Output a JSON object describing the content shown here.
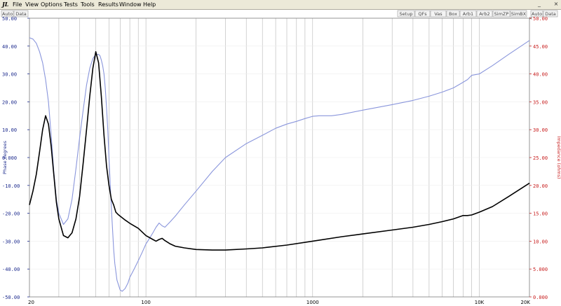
{
  "menubar": {
    "items": [
      "File",
      "View",
      "Options",
      "Tests",
      "Tools",
      "Results",
      "Window",
      "Help"
    ],
    "window_controls": [
      "_",
      "×"
    ]
  },
  "toolbar": {
    "left_buttons": [
      "Auto",
      "Data"
    ],
    "right_buttons": [
      "Setup",
      "QFs",
      "Vas",
      "Box",
      "Arb1",
      "Arb2",
      "SimZP",
      "SimBX"
    ],
    "right_axis_buttons": [
      "Auto",
      "Data"
    ],
    "close_glyph": "×"
  },
  "colors": {
    "phase": "#8a96dc",
    "impedance": "#000000",
    "left_axis": "#1e2c8e",
    "right_axis": "#c82020",
    "grid": "#b4b4b4"
  },
  "chart_data": {
    "type": "line",
    "xscale": "log",
    "xlim": [
      20,
      20000
    ],
    "x_tick_labels": [
      "20",
      "100",
      "1000",
      "10K",
      "20K"
    ],
    "ylabel": "Phase degrees",
    "ylim": [
      -50,
      50
    ],
    "y_tick_labels": [
      "50.00",
      "40.00",
      "30.00",
      "20.00",
      "10.00",
      "0.000",
      "-10.00",
      "-20.00",
      "-30.00",
      "-40.00",
      "-50.00"
    ],
    "y2label": "Impedance (ohms)",
    "y2lim": [
      0,
      50
    ],
    "y2_tick_labels": [
      "50.00",
      "45.00",
      "40.00",
      "35.00",
      "30.00",
      "25.00",
      "20.00",
      "15.00",
      "10.00",
      "5.000",
      "0.000"
    ],
    "grid": true,
    "series": [
      {
        "axis": "left",
        "color": "#8a96dc",
        "x": [
          20,
          21,
          22,
          23,
          24,
          25,
          26,
          27,
          28,
          29,
          30,
          32,
          34,
          36,
          38,
          40,
          42,
          44,
          46,
          48,
          50,
          52,
          53,
          54,
          55,
          56,
          57,
          58,
          59,
          60,
          62,
          64,
          65,
          67,
          70,
          72,
          75,
          78,
          80,
          85,
          90,
          95,
          100,
          105,
          110,
          115,
          120,
          125,
          130,
          140,
          150,
          170,
          200,
          250,
          300,
          400,
          500,
          600,
          700,
          800,
          900,
          1000,
          1100,
          1300,
          1500,
          2000,
          3000,
          4000,
          5000,
          6000,
          7000,
          8000,
          8500,
          9000,
          10000,
          12000,
          15000,
          20000
        ],
        "y": [
          43,
          42.5,
          41,
          38,
          34,
          28,
          20,
          8,
          -5,
          -15,
          -20,
          -24,
          -22,
          -15,
          -4,
          7,
          17,
          26,
          32,
          35.5,
          37,
          37,
          36.5,
          35,
          33,
          30,
          25,
          18,
          10,
          0,
          -18,
          -33,
          -38,
          -44,
          -47.5,
          -48,
          -47,
          -45,
          -43,
          -40,
          -37,
          -34,
          -31,
          -29,
          -27,
          -25,
          -23.5,
          -24.5,
          -25,
          -23,
          -21,
          -17,
          -12,
          -5,
          0,
          5,
          8,
          10.5,
          12,
          13,
          14,
          14.8,
          15,
          15,
          15.5,
          17,
          19,
          20.5,
          22,
          23.5,
          25,
          27,
          28,
          29.5,
          30,
          33,
          37,
          42
        ]
      },
      {
        "axis": "right",
        "color": "#000000",
        "x": [
          20,
          21,
          22,
          23,
          24,
          25,
          26,
          27,
          28,
          29,
          30,
          32,
          34,
          36,
          38,
          40,
          42,
          44,
          46,
          48,
          50,
          52,
          54,
          56,
          58,
          60,
          62,
          64,
          66,
          68,
          70,
          75,
          80,
          90,
          100,
          110,
          115,
          120,
          125,
          130,
          140,
          150,
          170,
          200,
          250,
          300,
          400,
          500,
          700,
          1000,
          1500,
          2000,
          3000,
          4000,
          5000,
          6000,
          7000,
          8000,
          8500,
          9000,
          10000,
          12000,
          15000,
          20000
        ],
        "y": [
          16.5,
          19,
          22,
          26,
          30,
          32.5,
          31,
          27,
          22,
          17,
          14,
          11,
          10.6,
          11.5,
          14,
          18,
          24,
          30,
          36,
          41,
          44,
          42,
          36,
          29,
          23.5,
          20,
          17.5,
          16.5,
          15.2,
          14.8,
          14.5,
          13.8,
          13.2,
          12.3,
          11,
          10.3,
          10,
          10.3,
          10.5,
          10.1,
          9.5,
          9.1,
          8.8,
          8.5,
          8.4,
          8.4,
          8.6,
          8.8,
          9.3,
          10,
          10.8,
          11.3,
          12,
          12.5,
          13,
          13.5,
          14,
          14.6,
          14.6,
          14.7,
          15.2,
          16.2,
          18,
          20.4
        ]
      }
    ]
  }
}
